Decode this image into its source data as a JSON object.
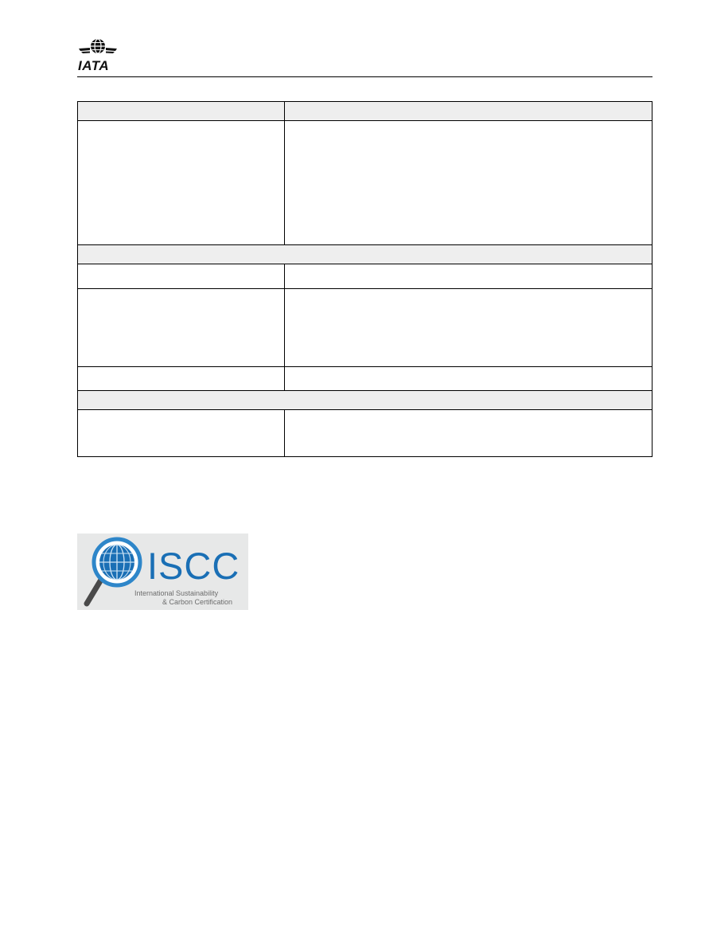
{
  "header": {
    "logo_text": "IATA"
  },
  "logo_iscc": {
    "wordmark": "ISCC",
    "subtitle_line1": "International Sustainability",
    "subtitle_line2": "& Carbon Certification"
  }
}
